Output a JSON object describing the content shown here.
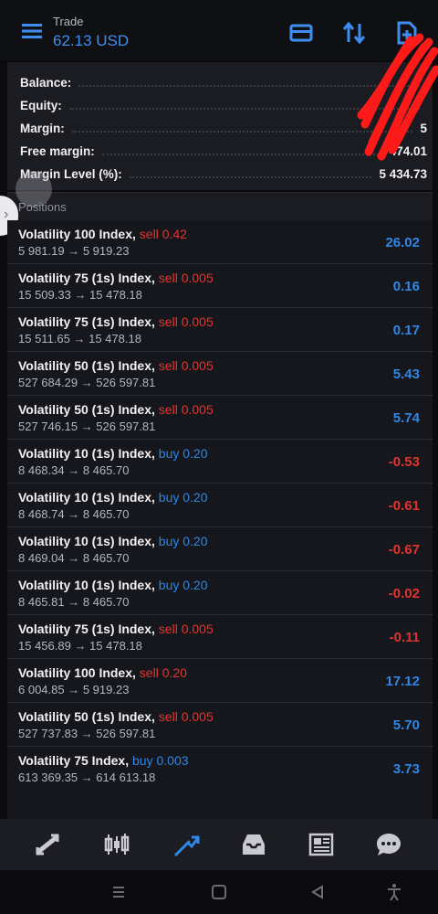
{
  "header": {
    "title_small": "Trade",
    "title_main": "62.13 USD",
    "icons": [
      "menu-icon",
      "card-icon",
      "sort-icon",
      "new-order-icon"
    ]
  },
  "account": {
    "rows": [
      {
        "label": "Balance:",
        "value": ""
      },
      {
        "label": "Equity:",
        "value": ""
      },
      {
        "label": "Margin:",
        "value": "5"
      },
      {
        "label": "Free margin:",
        "value": "474.01"
      },
      {
        "label": "Margin Level (%):",
        "value": "5 434.73"
      }
    ]
  },
  "positions": {
    "label": "Positions",
    "items": [
      {
        "symbol": "Volatility 100 Index,",
        "side": "sell 0.42",
        "dir": "sell",
        "prices": "5 981.19 → 5 919.23",
        "profit": "26.02",
        "sign": "pos"
      },
      {
        "symbol": "Volatility 75 (1s) Index,",
        "side": "sell 0.005",
        "dir": "sell",
        "prices": "15 509.33 → 15 478.18",
        "profit": "0.16",
        "sign": "pos"
      },
      {
        "symbol": "Volatility 75 (1s) Index,",
        "side": "sell 0.005",
        "dir": "sell",
        "prices": "15 511.65 → 15 478.18",
        "profit": "0.17",
        "sign": "pos"
      },
      {
        "symbol": "Volatility 50 (1s) Index,",
        "side": "sell 0.005",
        "dir": "sell",
        "prices": "527 684.29 → 526 597.81",
        "profit": "5.43",
        "sign": "pos"
      },
      {
        "symbol": "Volatility 50 (1s) Index,",
        "side": "sell 0.005",
        "dir": "sell",
        "prices": "527 746.15 → 526 597.81",
        "profit": "5.74",
        "sign": "pos"
      },
      {
        "symbol": "Volatility 10 (1s) Index,",
        "side": "buy 0.20",
        "dir": "buy",
        "prices": "8 468.34 → 8 465.70",
        "profit": "-0.53",
        "sign": "neg"
      },
      {
        "symbol": "Volatility 10 (1s) Index,",
        "side": "buy 0.20",
        "dir": "buy",
        "prices": "8 468.74 → 8 465.70",
        "profit": "-0.61",
        "sign": "neg"
      },
      {
        "symbol": "Volatility 10 (1s) Index,",
        "side": "buy 0.20",
        "dir": "buy",
        "prices": "8 469.04 → 8 465.70",
        "profit": "-0.67",
        "sign": "neg"
      },
      {
        "symbol": "Volatility 10 (1s) Index,",
        "side": "buy 0.20",
        "dir": "buy",
        "prices": "8 465.81 → 8 465.70",
        "profit": "-0.02",
        "sign": "neg"
      },
      {
        "symbol": "Volatility 75 (1s) Index,",
        "side": "sell 0.005",
        "dir": "sell",
        "prices": "15 456.89 → 15 478.18",
        "profit": "-0.11",
        "sign": "neg"
      },
      {
        "symbol": "Volatility 100 Index,",
        "side": "sell 0.20",
        "dir": "sell",
        "prices": "6 004.85 → 5 919.23",
        "profit": "17.12",
        "sign": "pos"
      },
      {
        "symbol": "Volatility 50 (1s) Index,",
        "side": "sell 0.005",
        "dir": "sell",
        "prices": "527 737.83 → 526 597.81",
        "profit": "5.70",
        "sign": "pos"
      },
      {
        "symbol": "Volatility 75 Index,",
        "side": "buy 0.003",
        "dir": "buy",
        "prices": "613 369.35 → 614 613.18",
        "profit": "3.73",
        "sign": "pos"
      }
    ]
  },
  "bottom_nav": [
    "quotes-icon",
    "chart-icon",
    "trade-icon",
    "history-icon",
    "news-icon",
    "messages-icon"
  ],
  "colors": {
    "accent": "#2f87e6",
    "loss": "#e0352f",
    "background": "#0b0b0d"
  }
}
